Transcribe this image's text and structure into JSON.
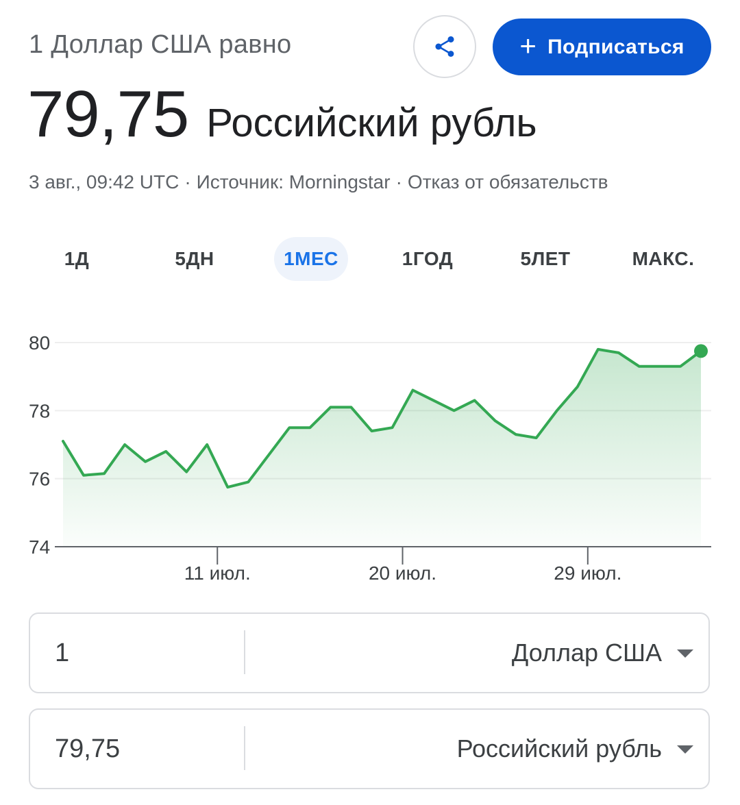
{
  "header": {
    "subtitle": "1 Доллар США равно",
    "subscribe_label": "Подписаться",
    "subscribe_icon": "plus-icon",
    "share_icon": "share-icon"
  },
  "rate": {
    "value": "79,75",
    "currency": "Российский рубль"
  },
  "meta": {
    "timestamp": "3 авг., 09:42 UTC",
    "source": "Источник: Morningstar",
    "disclaimer": "Отказ от обязательств"
  },
  "tabs": [
    {
      "label": "1Д"
    },
    {
      "label": "5ДН"
    },
    {
      "label": "1МЕС",
      "active": true
    },
    {
      "label": "1ГОД"
    },
    {
      "label": "5ЛЕТ"
    },
    {
      "label": "МАКС."
    }
  ],
  "colors": {
    "accent": "#0b57d0",
    "active_tab": "#1a73e8",
    "line": "#34a853"
  },
  "chart_data": {
    "type": "area",
    "ylim": [
      74,
      80
    ],
    "y_ticks": [
      80,
      78,
      76,
      74
    ],
    "x_ticks": [
      {
        "label": "11 июл.",
        "index": 7.5
      },
      {
        "label": "20 июл.",
        "index": 16.5
      },
      {
        "label": "29 июл.",
        "index": 25.5
      }
    ],
    "grid": true,
    "series": [
      {
        "values": [
          77.1,
          76.1,
          76.15,
          77.0,
          76.5,
          76.8,
          76.2,
          77.0,
          75.75,
          75.9,
          76.7,
          77.5,
          77.5,
          78.1,
          78.1,
          77.4,
          77.5,
          78.6,
          78.3,
          78.0,
          78.3,
          77.7,
          77.3,
          77.2,
          78.0,
          78.7,
          79.8,
          79.7,
          79.3,
          79.3,
          79.3,
          79.75
        ]
      }
    ]
  },
  "converter": {
    "from": {
      "amount": "1",
      "currency": "Доллар США"
    },
    "to": {
      "amount": "79,75",
      "currency": "Российский рубль"
    }
  }
}
